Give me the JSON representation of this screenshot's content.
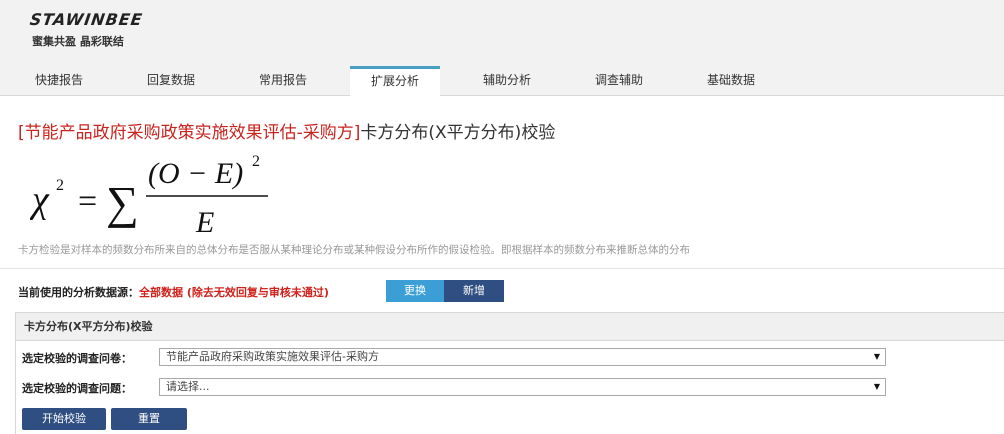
{
  "brand": {
    "name": "STAWINBEE",
    "slogan": "蜜集共盈 晶彩联结"
  },
  "nav": {
    "tabs": [
      {
        "label": "快捷报告"
      },
      {
        "label": "回复数据"
      },
      {
        "label": "常用报告"
      },
      {
        "label": "扩展分析",
        "active": true
      },
      {
        "label": "辅助分析"
      },
      {
        "label": "调查辅助"
      },
      {
        "label": "基础数据"
      }
    ]
  },
  "page": {
    "title_project": "[节能产品政府采购政策实施效果评估-采购方]",
    "title_method": "卡方分布(X平方分布)校验",
    "description": "卡方检验是对样本的频数分布所来自的总体分布是否服从某种理论分布或某种假设分布所作的假设检验。即根据样本的频数分布来推断总体的分布"
  },
  "formula": {
    "lhs": "χ",
    "lhs_exp": "2",
    "equals": "=",
    "sigma": "∑",
    "numerator": "(O − E)",
    "numerator_exp": "2",
    "denominator": "E"
  },
  "data_source": {
    "label": "当前使用的分析数据源：",
    "value": "全部数据 (除去无效回复与审核未通过)",
    "change_button": "更换",
    "new_button": "新增"
  },
  "panel": {
    "heading": "卡方分布(X平方分布)校验",
    "questionnaire_label": "选定校验的调查问卷：",
    "questionnaire_value": "节能产品政府采购政策实施效果评估-采购方",
    "question_label": "选定校验的调查问题：",
    "question_value": "请选择...",
    "start_button": "开始校验",
    "reset_button": "重置"
  },
  "colors": {
    "accent_blue": "#3b9fd6",
    "navy": "#2f4f82",
    "title_red": "#c9241d",
    "tab_active_border": "#4a9fc4"
  }
}
